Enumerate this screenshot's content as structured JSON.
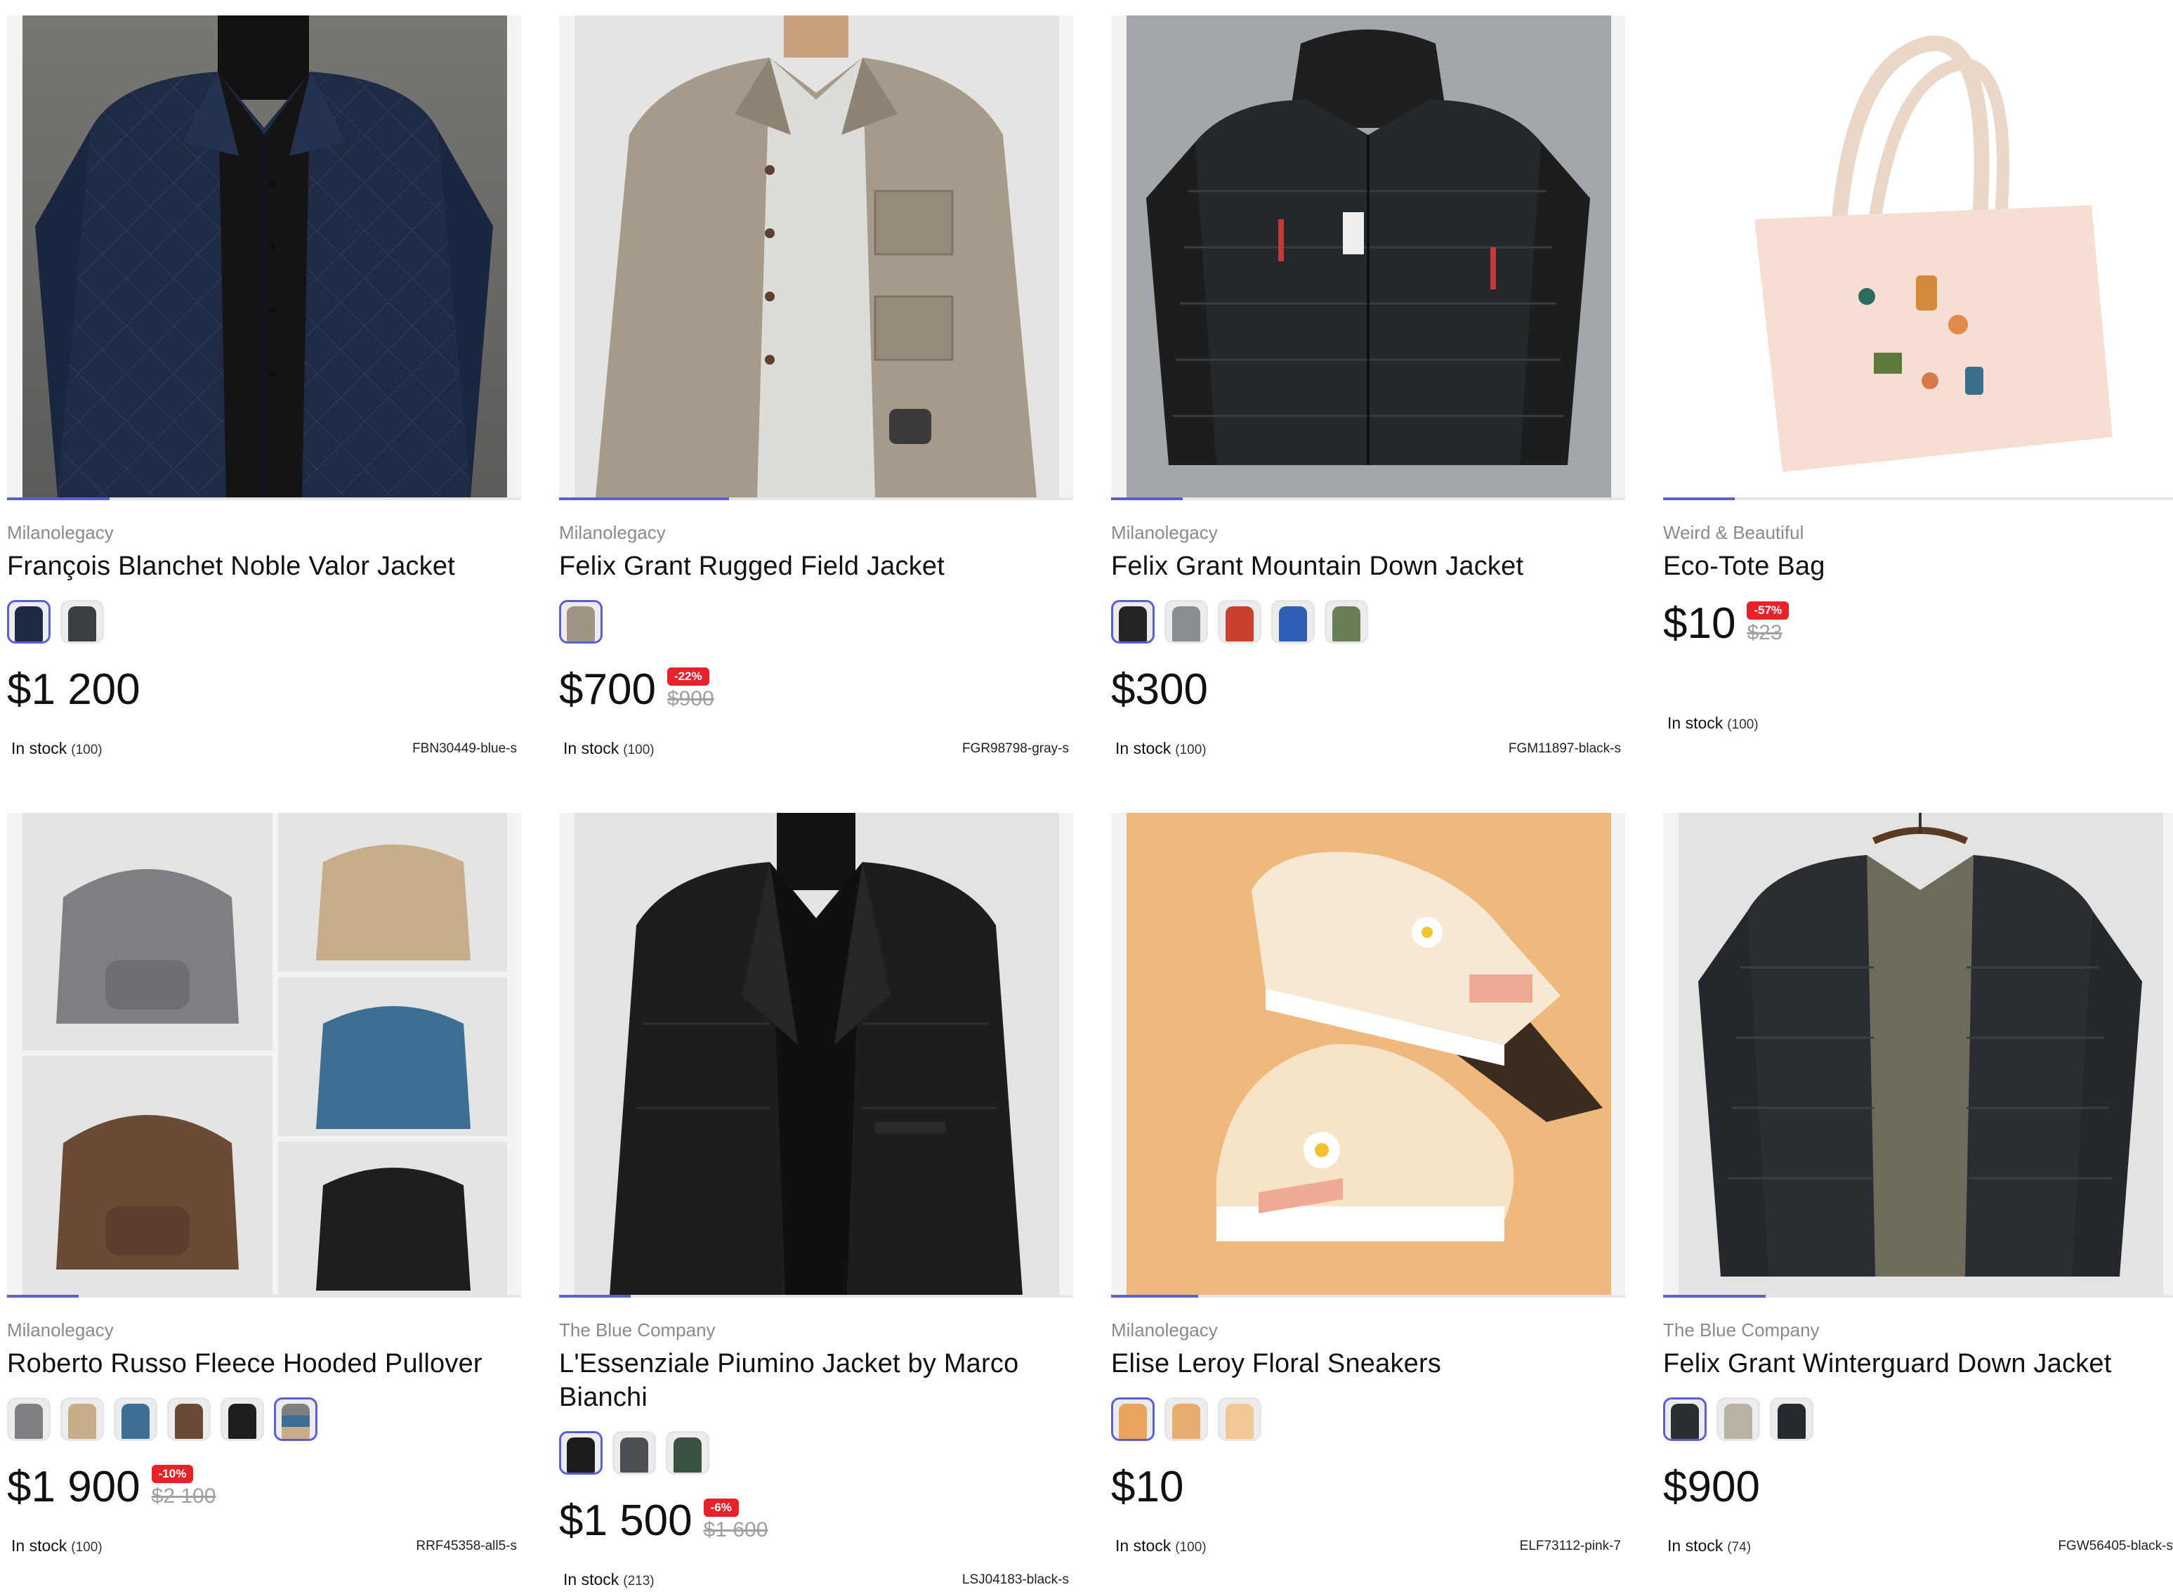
{
  "products": [
    {
      "brand": "Milanolegacy",
      "title": "François Blanchet Noble Valor Jacket",
      "price": "$1 200",
      "discount": "",
      "old_price": "",
      "stock_label": "In stock",
      "stock_count": "(100)",
      "sku": "FBN30449-blue-s",
      "image_progress": 0.2,
      "swatches": [
        "navy-jacket",
        "charcoal-jacket"
      ],
      "swatch_colors": [
        "#1e2a44",
        "#3a3f44"
      ],
      "active_swatch": 0
    },
    {
      "brand": "Milanolegacy",
      "title": "Felix Grant Rugged Field Jacket",
      "price": "$700",
      "discount": "-22%",
      "old_price": "$900",
      "stock_label": "In stock",
      "stock_count": "(100)",
      "sku": "FGR98798-gray-s",
      "image_progress": 0.33,
      "swatches": [
        "gray-jacket"
      ],
      "swatch_colors": [
        "#a09585"
      ],
      "active_swatch": 0
    },
    {
      "brand": "Milanolegacy",
      "title": "Felix Grant Mountain Down Jacket",
      "price": "$300",
      "discount": "",
      "old_price": "",
      "stock_label": "In stock",
      "stock_count": "(100)",
      "sku": "FGM11897-black-s",
      "image_progress": 0.14,
      "swatches": [
        "black-down-jacket",
        "gray-down-jacket",
        "red-down-jacket",
        "blue-down-jacket",
        "green-down-jacket"
      ],
      "swatch_colors": [
        "#222426",
        "#8a8d90",
        "#c7412e",
        "#2f5fb4",
        "#6b7f57"
      ],
      "active_swatch": 0
    },
    {
      "brand": "Weird & Beautiful",
      "title": "Eco-Tote Bag",
      "price": "$10",
      "discount": "-57%",
      "old_price": "$23",
      "stock_label": "In stock",
      "stock_count": "(100)",
      "sku": "",
      "image_progress": 0.14,
      "swatches": [],
      "swatch_colors": [],
      "active_swatch": -1
    },
    {
      "brand": "Milanolegacy",
      "title": "Roberto Russo Fleece Hooded Pullover",
      "price": "$1 900",
      "discount": "-10%",
      "old_price": "$2 100",
      "stock_label": "In stock",
      "stock_count": "(100)",
      "sku": "RRF45358-all5-s",
      "image_progress": 0.14,
      "swatches": [
        "gray-hoodie",
        "beige-hoodie",
        "blue-hoodie",
        "brown-hoodie",
        "black-hoodie",
        "all-colors-hoodie"
      ],
      "swatch_colors": [
        "#7d7f82",
        "#c8ad8a",
        "#3c6f93",
        "#6b4a36",
        "#1e1e1e",
        "#4b5e72"
      ],
      "active_swatch": 5
    },
    {
      "brand": "The Blue Company",
      "title": "L'Essenziale Piumino Jacket by Marco Bianchi",
      "price": "$1 500",
      "discount": "-6%",
      "old_price": "$1 600",
      "stock_label": "In stock",
      "stock_count": "(213)",
      "sku": "LSJ04183-black-s",
      "image_progress": 0.14,
      "swatches": [
        "black-blazer",
        "charcoal-blazer",
        "green-blazer"
      ],
      "swatch_colors": [
        "#1b1c1e",
        "#4c5054",
        "#3a5242"
      ],
      "active_swatch": 0
    },
    {
      "brand": "Milanolegacy",
      "title": "Elise Leroy Floral Sneakers",
      "price": "$10",
      "discount": "",
      "old_price": "",
      "stock_label": "In stock",
      "stock_count": "(100)",
      "sku": "ELF73112-pink-7",
      "image_progress": 0.17,
      "swatches": [
        "pink-sneakers",
        "orange-sneakers",
        "white-sneakers"
      ],
      "swatch_colors": [
        "#e8a45d",
        "#e6ad6e",
        "#f0c896"
      ],
      "active_swatch": 0
    },
    {
      "brand": "The Blue Company",
      "title": "Felix Grant Winterguard Down Jacket",
      "price": "$900",
      "discount": "",
      "old_price": "",
      "stock_label": "In stock",
      "stock_count": "(74)",
      "sku": "FGW56405-black-s",
      "image_progress": 0.2,
      "swatches": [
        "black-down-jacket",
        "khaki-down-jacket",
        "dark-down-jacket"
      ],
      "swatch_colors": [
        "#2a2d31",
        "#b9b1a2",
        "#25282c"
      ],
      "active_swatch": 0
    }
  ],
  "colors": {
    "accent": "#5a5fd6",
    "discount_badge": "#e8212a",
    "brand_text": "#8a8a8a",
    "old_price": "#a0a0a0"
  }
}
